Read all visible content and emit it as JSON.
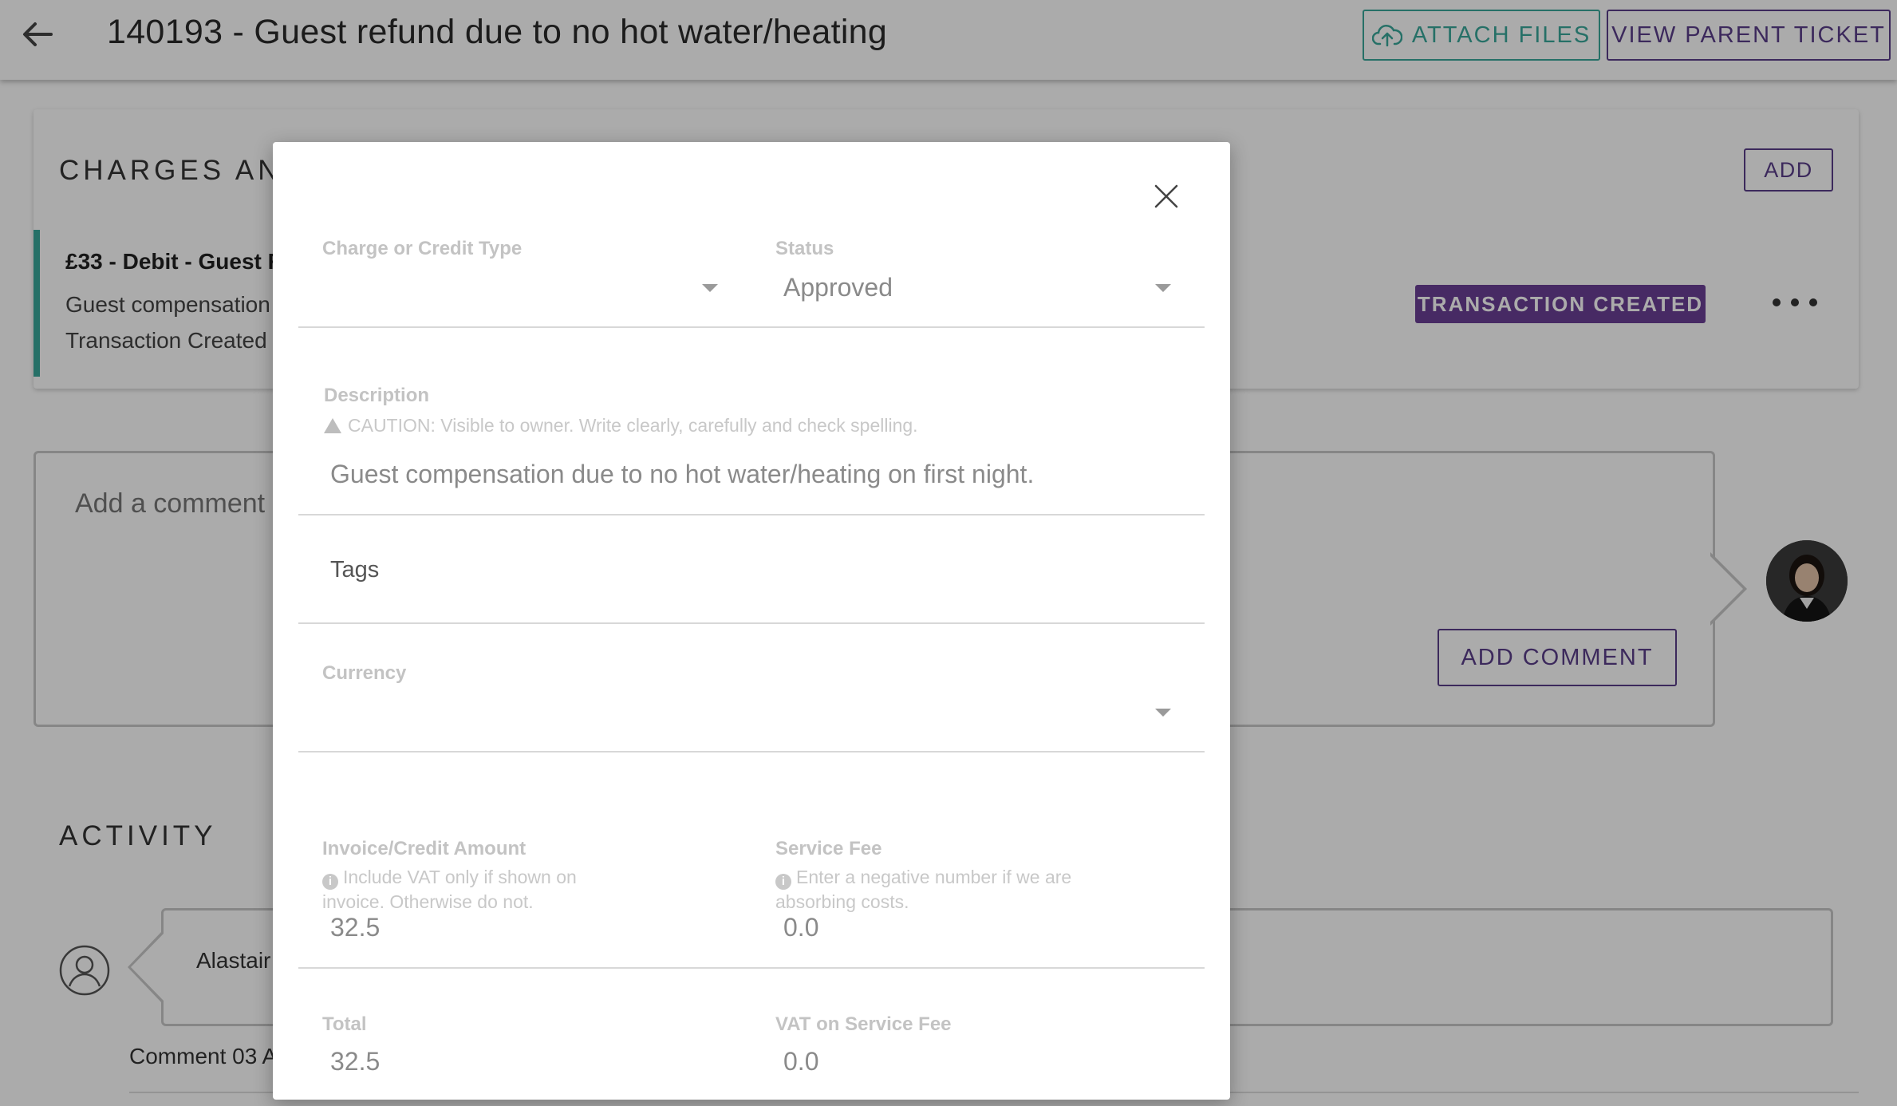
{
  "header": {
    "title": "140193 - Guest refund due to no hot water/heating",
    "attach_label": "ATTACH FILES",
    "parent_label": "VIEW PARENT TICKET"
  },
  "charges": {
    "heading": "CHARGES AND",
    "add_label": "ADD",
    "item": {
      "title": "£33 - Debit - Guest R",
      "line1": "Guest compensation",
      "line2": "Transaction Created -",
      "badge": "TRANSACTION CREATED"
    }
  },
  "comment": {
    "placeholder": "Add a comment",
    "button_label": "ADD COMMENT"
  },
  "activity": {
    "heading": "ACTIVITY",
    "author": "Alastair",
    "meta": "Comment 03 A"
  },
  "modal": {
    "charge_type": {
      "label": "Charge or Credit Type",
      "value": ""
    },
    "status": {
      "label": "Status",
      "value": "Approved"
    },
    "description": {
      "label": "Description",
      "caution": "CAUTION: Visible to owner. Write clearly, carefully and check spelling.",
      "value": "Guest compensation due to no hot water/heating on first night."
    },
    "tags": {
      "placeholder": "Tags"
    },
    "currency": {
      "label": "Currency",
      "value": ""
    },
    "invoice_amount": {
      "label": "Invoice/Credit Amount",
      "help": "Include VAT only if shown on invoice. Otherwise do not.",
      "value": "32.5"
    },
    "service_fee": {
      "label": "Service Fee",
      "help": "Enter a negative number if we are absorbing costs.",
      "value": "0.0"
    },
    "total": {
      "label": "Total",
      "value": "32.5"
    },
    "vat_service_fee": {
      "label": "VAT on Service Fee",
      "value": "0.0"
    }
  },
  "colors": {
    "accent_teal": "#3aa89a",
    "accent_purple": "#5a3e8a",
    "badge_purple": "#6b3f95"
  }
}
